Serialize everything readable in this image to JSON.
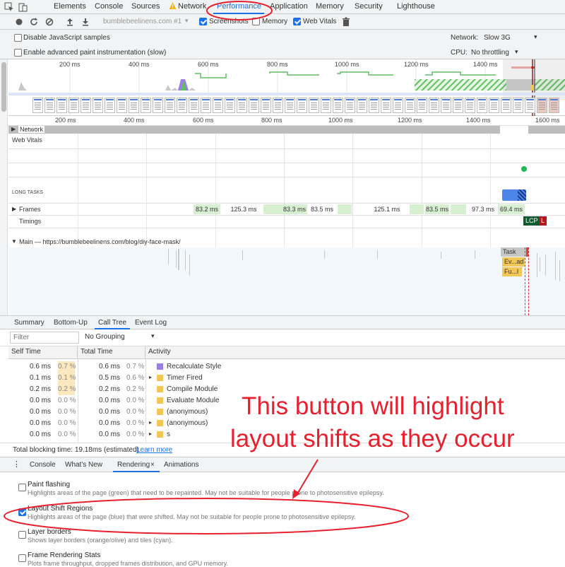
{
  "top_tabs": [
    "Elements",
    "Console",
    "Sources",
    "Network",
    "Performance",
    "Application",
    "Memory",
    "Security",
    "Lighthouse"
  ],
  "toolbar": {
    "profile_select": "bumblebeelinens.com #1",
    "screenshots_label": "Screenshots",
    "memory_label": "Memory",
    "web_vitals_label": "Web Vitals"
  },
  "settings": {
    "disable_js_label": "Disable JavaScript samples",
    "paint_instr_label": "Enable advanced paint instrumentation (slow)",
    "network_label": "Network:",
    "network_value": "Slow 3G",
    "cpu_label": "CPU:",
    "cpu_value": "No throttling"
  },
  "ruler_ticks": [
    "200 ms",
    "400 ms",
    "600 ms",
    "800 ms",
    "1000 ms",
    "1200 ms",
    "1400 ms",
    "1600 ms"
  ],
  "tracks": {
    "network": "Network",
    "web_vitals": "Web Vitals",
    "long_tasks": "LONG TASKS",
    "frames": "Frames",
    "timings": "Timings",
    "lcp": "LCP",
    "l": "L",
    "main": "Main — https://bumblebeelinens.com/blog/diy-face-mask/",
    "task": "Task",
    "ev": "Ev...ad",
    "fu": "Fu...l"
  },
  "frames": [
    "83.2 ms",
    "125.3 ms",
    "83.3 ms",
    "83.5 ms",
    "125.1 ms",
    "83.5 ms",
    "97.3 ms",
    "69.4 ms"
  ],
  "bottom_tabs": [
    "Summary",
    "Bottom-Up",
    "Call Tree",
    "Event Log"
  ],
  "filter_placeholder": "Filter",
  "grouping": "No Grouping",
  "columns": [
    "Self Time",
    "Total Time",
    "Activity"
  ],
  "call_tree_rows": [
    {
      "self": "0.6 ms",
      "self_pct": "0.7 %",
      "total": "0.6 ms",
      "total_pct": "0.7 %",
      "expand": "",
      "color": "#9b7fe6",
      "activity": "Recalculate Style"
    },
    {
      "self": "0.1 ms",
      "self_pct": "0.1 %",
      "total": "0.5 ms",
      "total_pct": "0.6 %",
      "expand": "▸",
      "color": "#f2c657",
      "activity": "Timer Fired"
    },
    {
      "self": "0.2 ms",
      "self_pct": "0.2 %",
      "total": "0.2 ms",
      "total_pct": "0.2 %",
      "expand": "",
      "color": "#f2c657",
      "activity": "Compile Module"
    },
    {
      "self": "0.0 ms",
      "self_pct": "0.0 %",
      "total": "0.0 ms",
      "total_pct": "0.0 %",
      "expand": "",
      "color": "#f2c657",
      "activity": "Evaluate Module"
    },
    {
      "self": "0.0 ms",
      "self_pct": "0.0 %",
      "total": "0.0 ms",
      "total_pct": "0.0 %",
      "expand": "",
      "color": "#f2c657",
      "activity": "(anonymous)"
    },
    {
      "self": "0.0 ms",
      "self_pct": "0.0 %",
      "total": "0.0 ms",
      "total_pct": "0.0 %",
      "expand": "▸",
      "color": "#f2c657",
      "activity": "(anonymous)"
    },
    {
      "self": "0.0 ms",
      "self_pct": "0.0 %",
      "total": "0.0 ms",
      "total_pct": "0.0 %",
      "expand": "▸",
      "color": "#f2c657",
      "activity": "s"
    }
  ],
  "blocking": {
    "text": "Total blocking time: 19.18ms (estimated)",
    "link": "Learn more"
  },
  "drawer_tabs": [
    "Console",
    "What's New",
    "Rendering",
    "Animations"
  ],
  "drawer_close": "×",
  "rendering_options": [
    {
      "title": "Paint flashing",
      "desc": "Highlights areas of the page (green) that need to be repainted. May not be suitable for people prone to photosensitive epilepsy.",
      "checked": false
    },
    {
      "title": "Layout Shift Regions",
      "desc": "Highlights areas of the page (blue) that were shifted. May not be suitable for people prone to photosensitive epilepsy.",
      "checked": true
    },
    {
      "title": "Layer borders",
      "desc": "Shows layer borders (orange/olive) and tiles (cyan).",
      "checked": false
    },
    {
      "title": "Frame Rendering Stats",
      "desc": "Plots frame throughput, dropped frames distribution, and GPU memory.",
      "checked": false
    }
  ],
  "annotation": {
    "line1": "This button will highlight",
    "line2": "layout shifts as they occur"
  },
  "colors": {
    "accent": "#1a73e8",
    "annotation": "#e8202d",
    "frame_green": "#d7f0d1",
    "task_gray": "#c7c7c7",
    "script_yellow": "#f2c657"
  }
}
